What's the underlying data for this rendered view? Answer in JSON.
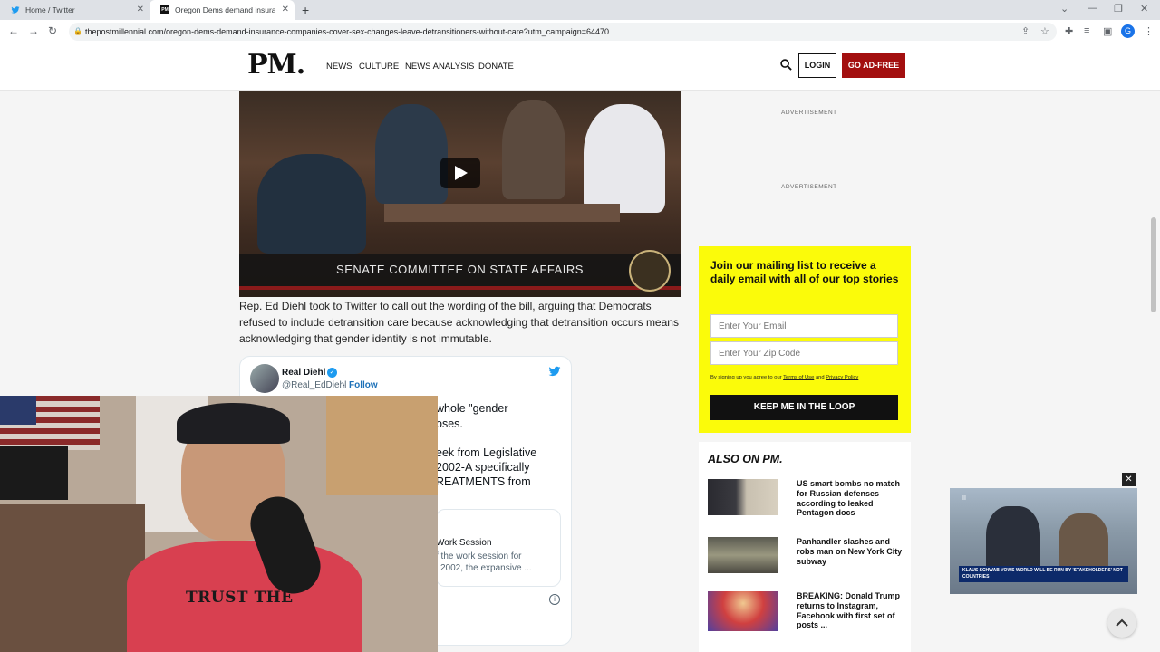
{
  "browser": {
    "tabs": [
      {
        "title": "Home / Twitter",
        "active": false
      },
      {
        "title": "Oregon Dems demand insurance",
        "active": true
      }
    ],
    "url": "thepostmillennial.com/oregon-dems-demand-insurance-companies-cover-sex-changes-leave-detransitioners-without-care?utm_campaign=64470",
    "profile_initial": "G"
  },
  "site": {
    "logo": "PM.",
    "nav": [
      "NEWS",
      "CULTURE",
      "NEWS ANALYSIS",
      "DONATE"
    ],
    "login_label": "LOGIN",
    "adfree_label": "GO AD-FREE",
    "brand_red": "#a30f0f"
  },
  "video": {
    "caption": "SENATE COMMITTEE ON STATE AFFAIRS"
  },
  "article": {
    "paragraph": "Rep. Ed Diehl took to Twitter to call out the wording of the bill, arguing that Democrats refused to include detransition care because acknowledging that detransition occurs means acknowledging that gender identity is not immutable."
  },
  "tweet": {
    "name": "Real Diehl",
    "handle": "@Real_EdDiehl",
    "follow_label": "Follow",
    "text_lines": [
      "whole \"gender",
      "oses.",
      "eek from Legislative",
      "2002-A specifically",
      "REATMENTS from"
    ],
    "card_lines": [
      "Work Session",
      "f the work session for",
      "l 2002, the expansive ..."
    ],
    "info_label": "i"
  },
  "sidebar": {
    "ad_label_1": "ADVERTISEMENT",
    "ad_label_2": "ADVERTISEMENT",
    "mailing": {
      "heading": "Join our mailing list to receive a daily email with all of our top stories",
      "email_placeholder": "Enter Your Email",
      "zip_placeholder": "Enter Your Zip Code",
      "legal_prefix": "By signing up you agree to our",
      "terms": "Terms of Use",
      "and": "and",
      "privacy": "Privacy Policy",
      "button": "KEEP ME IN THE LOOP",
      "bg_color": "#fbfb0a"
    },
    "also_on": {
      "title": "ALSO ON PM.",
      "stories": [
        {
          "title": "US smart bombs no match for Russian defenses according to leaked Pentagon docs"
        },
        {
          "title": "Panhandler slashes and robs man on New York City subway"
        },
        {
          "title": "BREAKING: Donald Trump returns to Instagram, Facebook with first set of posts ..."
        }
      ]
    }
  },
  "float_video": {
    "ticker": "KLAUS SCHWAB VOWS WORLD WILL BE RUN BY 'STAKEHOLDERS' NOT COUNTRIES",
    "close_label": "✕",
    "pause_label": "II"
  },
  "webcam": {
    "shirt_text": "TRUST THE"
  }
}
